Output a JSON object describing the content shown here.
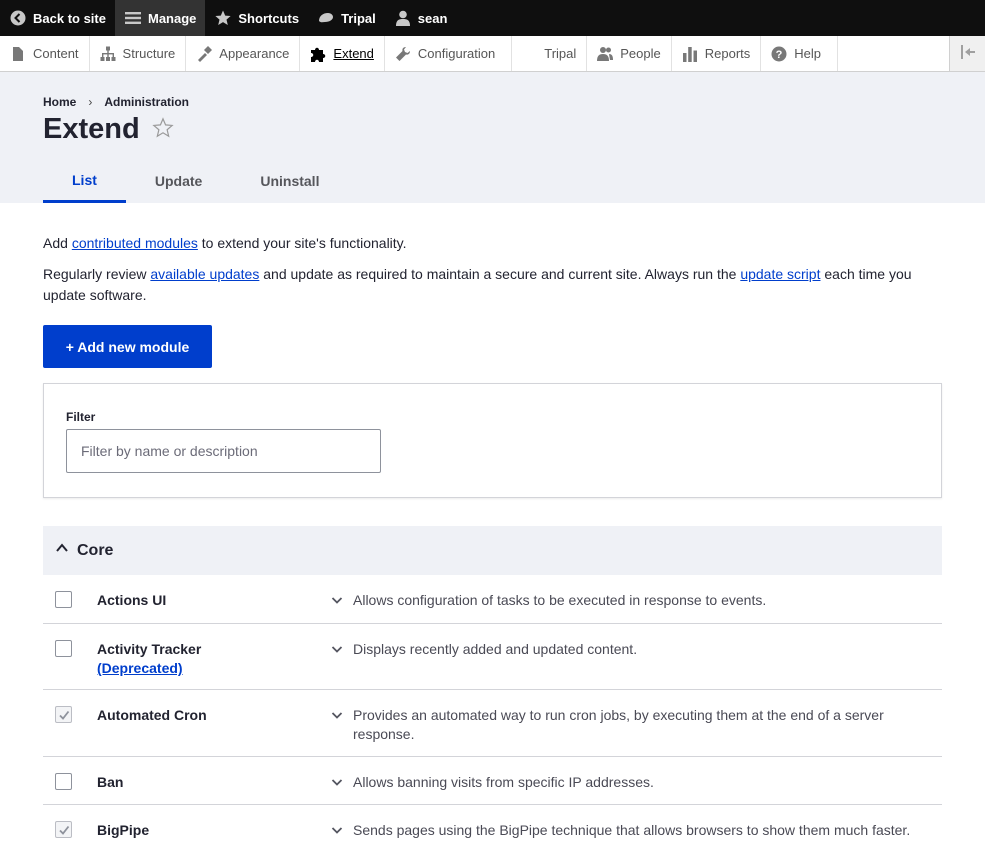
{
  "toolbar": {
    "back_label": "Back to site",
    "manage_label": "Manage",
    "shortcuts_label": "Shortcuts",
    "tripal_label": "Tripal",
    "user_label": "sean"
  },
  "tray": {
    "items": [
      {
        "label": "Content",
        "icon": "page-icon"
      },
      {
        "label": "Structure",
        "icon": "sitemap-icon"
      },
      {
        "label": "Appearance",
        "icon": "paint-icon"
      },
      {
        "label": "Extend",
        "icon": "puzzle-icon"
      },
      {
        "label": "Configuration",
        "icon": "wrench-icon"
      },
      {
        "label": "Tripal",
        "icon": ""
      },
      {
        "label": "People",
        "icon": "people-icon"
      },
      {
        "label": "Reports",
        "icon": "bar-chart-icon"
      },
      {
        "label": "Help",
        "icon": "help-icon"
      }
    ]
  },
  "breadcrumb": {
    "home": "Home",
    "separator": "›",
    "admin": "Administration"
  },
  "page": {
    "title": "Extend"
  },
  "tabs": [
    "List",
    "Update",
    "Uninstall"
  ],
  "intro": {
    "p1_before": "Add ",
    "p1_link": "contributed modules",
    "p1_after": " to extend your site's functionality.",
    "p2_before": "Regularly review ",
    "p2_link1": "available updates",
    "p2_mid": " and update as required to maintain a secure and current site. Always run the ",
    "p2_link2": "update script",
    "p2_after": " each time you update software."
  },
  "add_module_label": "+ Add new module",
  "filter": {
    "label": "Filter",
    "placeholder": "Filter by name or description"
  },
  "core": {
    "summary": "Core",
    "modules": [
      {
        "name": "Actions UI",
        "deprecated": "",
        "checked": false,
        "description": "Allows configuration of tasks to be executed in response to events."
      },
      {
        "name": "Activity Tracker",
        "deprecated": "(Deprecated)",
        "checked": false,
        "description": "Displays recently added and updated content."
      },
      {
        "name": "Automated Cron",
        "deprecated": "",
        "checked": true,
        "description": "Provides an automated way to run cron jobs, by executing them at the end of a server response."
      },
      {
        "name": "Ban",
        "deprecated": "",
        "checked": false,
        "description": "Allows banning visits from specific IP addresses."
      },
      {
        "name": "BigPipe",
        "deprecated": "",
        "checked": true,
        "description": "Sends pages using the BigPipe technique that allows browsers to show them much faster."
      }
    ]
  },
  "colors": {
    "accent": "#003ecc",
    "toolbar": "#0f0f0f",
    "header_bg": "#eff1f6"
  }
}
